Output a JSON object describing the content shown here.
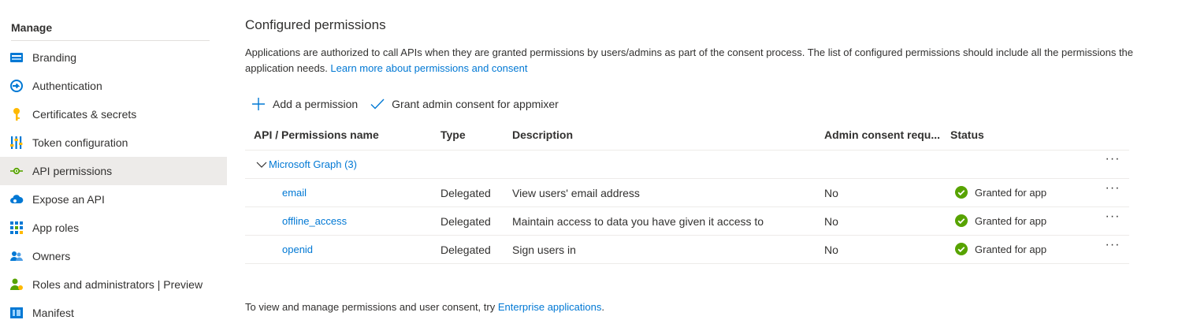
{
  "sidebar": {
    "heading": "Manage",
    "items": [
      {
        "label": "Branding",
        "icon": "branding-icon"
      },
      {
        "label": "Authentication",
        "icon": "authentication-icon"
      },
      {
        "label": "Certificates & secrets",
        "icon": "key-icon"
      },
      {
        "label": "Token configuration",
        "icon": "token-icon"
      },
      {
        "label": "API permissions",
        "icon": "api-permissions-icon",
        "active": true
      },
      {
        "label": "Expose an API",
        "icon": "cloud-icon"
      },
      {
        "label": "App roles",
        "icon": "grid-icon"
      },
      {
        "label": "Owners",
        "icon": "people-icon"
      },
      {
        "label": "Roles and administrators | Preview",
        "icon": "user-admin-icon"
      },
      {
        "label": "Manifest",
        "icon": "manifest-icon"
      }
    ]
  },
  "main": {
    "title": "Configured permissions",
    "intro_text": "Applications are authorized to call APIs when they are granted permissions by users/admins as part of the consent process. The list of configured permissions should include all the permissions the application needs. ",
    "intro_link": "Learn more about permissions and consent",
    "toolbar": {
      "add_label": "Add a permission",
      "grant_label": "Grant admin consent for appmixer"
    },
    "table": {
      "columns": [
        "API / Permissions name",
        "Type",
        "Description",
        "Admin consent requ...",
        "Status"
      ],
      "group": "Microsoft Graph (3)",
      "group_more": "···",
      "rows": [
        {
          "name": "email",
          "type": "Delegated",
          "description": "View users' email address",
          "admin": "No",
          "status": "Granted for app",
          "more": "···"
        },
        {
          "name": "offline_access",
          "type": "Delegated",
          "description": "Maintain access to data you have given it access to",
          "admin": "No",
          "status": "Granted for app",
          "more": "···"
        },
        {
          "name": "openid",
          "type": "Delegated",
          "description": "Sign users in",
          "admin": "No",
          "status": "Granted for app",
          "more": "···"
        }
      ]
    },
    "footer_text": "To view and manage permissions and user consent, try ",
    "footer_link": "Enterprise applications",
    "footer_end": "."
  },
  "colors": {
    "accent": "#0078d4",
    "success": "#57a300",
    "active_bg": "#edebe9"
  }
}
